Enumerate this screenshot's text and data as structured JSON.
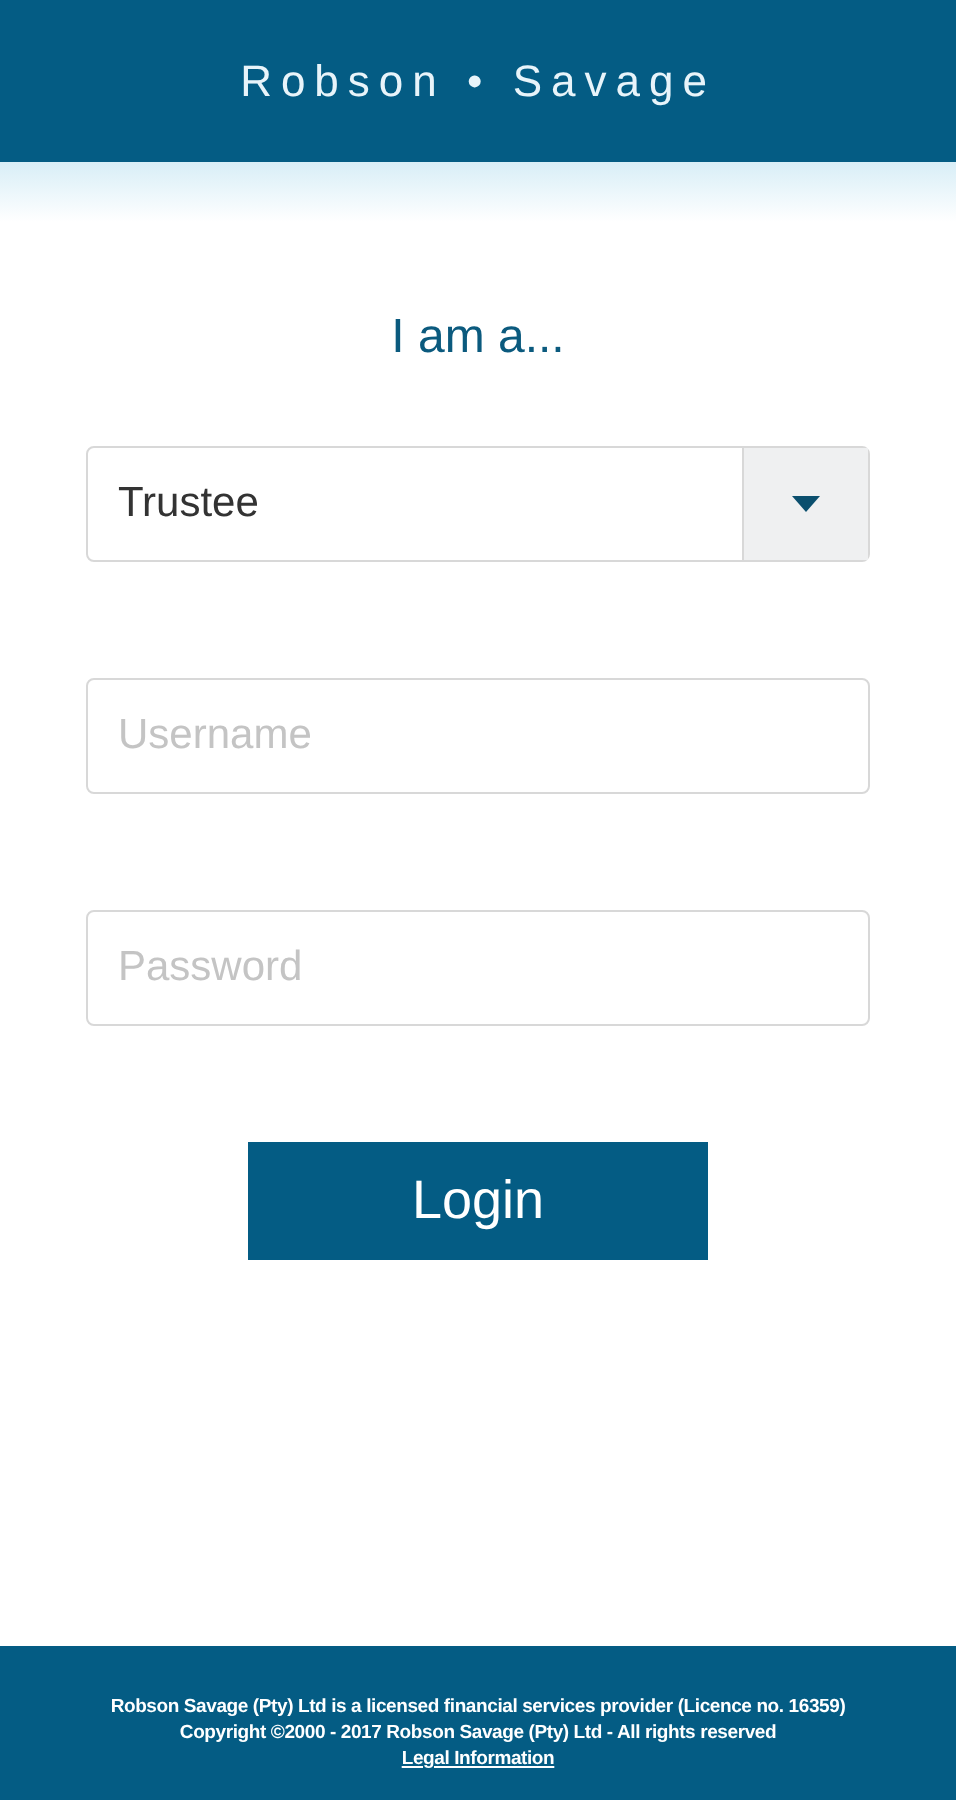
{
  "header": {
    "brand": "Robson • Savage"
  },
  "form": {
    "heading": "I am a...",
    "role_select": {
      "value": "Trustee"
    },
    "username": {
      "placeholder": "Username"
    },
    "password": {
      "placeholder": "Password"
    },
    "login_button": "Login"
  },
  "footer": {
    "lines": [
      "Robson Savage (Pty) Ltd is a licensed financial services provider (Licence no. 16359)",
      "Copyright ©2000 - 2017 Robson Savage (Pty) Ltd - All rights reserved"
    ],
    "link": "Legal Information"
  }
}
